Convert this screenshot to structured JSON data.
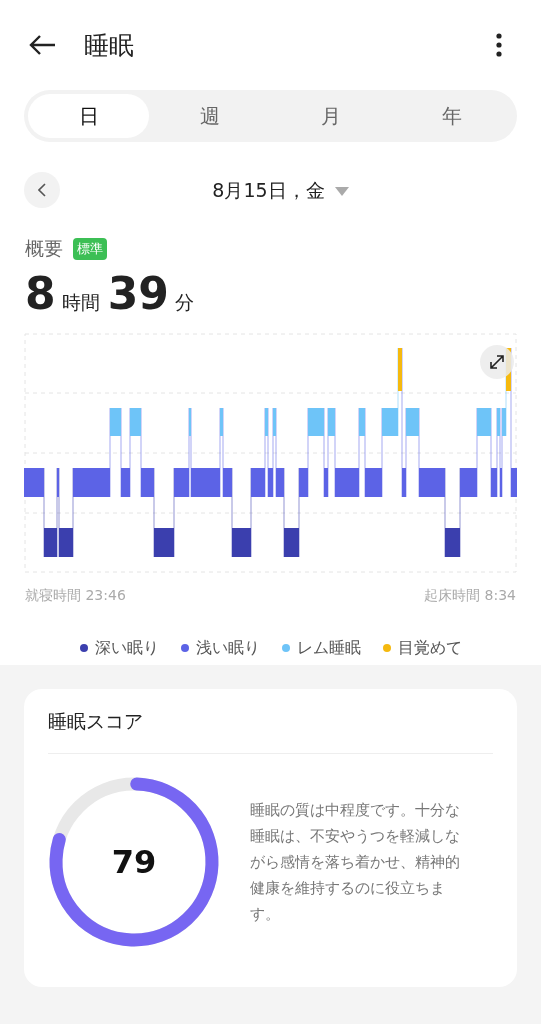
{
  "header": {
    "title": "睡眠"
  },
  "tabs": [
    {
      "label": "日",
      "selected": true
    },
    {
      "label": "週",
      "selected": false
    },
    {
      "label": "月",
      "selected": false
    },
    {
      "label": "年",
      "selected": false
    }
  ],
  "date": {
    "label": "8月15日，金"
  },
  "summary": {
    "label": "概要",
    "badge": "標準",
    "hours": "8",
    "hours_unit": "時間",
    "minutes": "39",
    "minutes_unit": "分"
  },
  "chart": {
    "bedtime": "就寝時間 23:46",
    "wake_time": "起床時間 8:34"
  },
  "legend": [
    {
      "label": "深い眠り",
      "color": "#3b3fae"
    },
    {
      "label": "浅い眠り",
      "color": "#5c63e6"
    },
    {
      "label": "レム睡眠",
      "color": "#6ec4f8"
    },
    {
      "label": "目覚めて",
      "color": "#f5b90f"
    }
  ],
  "score": {
    "title": "睡眠スコア",
    "value": "79",
    "description": "睡眠の質は中程度です。十分な睡眠は、不安やうつを軽減しながら感情を落ち着かせ、精神的健康を維持するのに役立ちます。"
  }
}
